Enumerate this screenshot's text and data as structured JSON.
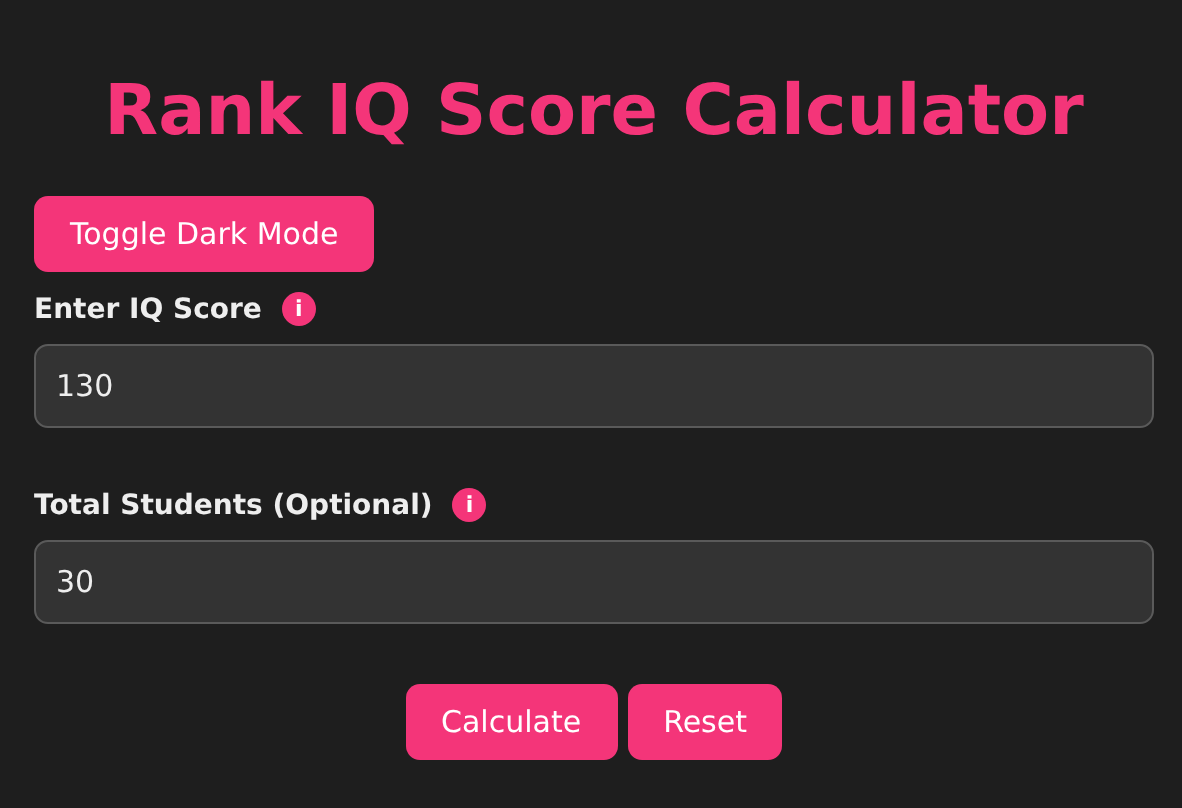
{
  "title": "Rank IQ Score Calculator",
  "toggle_button": "Toggle Dark Mode",
  "fields": [
    {
      "label": "Enter IQ Score",
      "info": "i",
      "value": "130"
    },
    {
      "label": "Total Students (Optional)",
      "info": "i",
      "value": "30"
    }
  ],
  "actions": [
    "Calculate",
    "Reset"
  ]
}
